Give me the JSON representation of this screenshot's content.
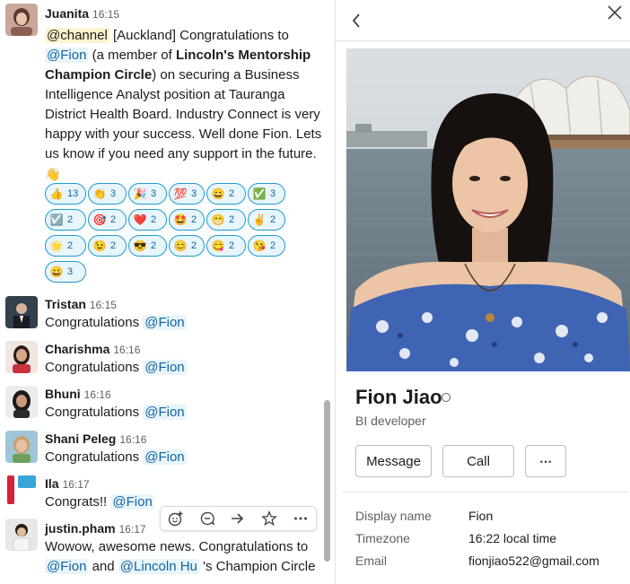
{
  "messages": [
    {
      "author": "Juanita",
      "time": "16:15",
      "parts": {
        "channel": "@channel",
        "p1": " [Auckland] Congratulations to ",
        "mention1": "@Fion",
        "p2": " (a member of ",
        "b1": "Lincoln's Mentorship Champion Circle",
        "p3": ") on securing a Business Intelligence Analyst position at Tauranga District Health Board. Industry Connect is very happy with your success. Well done Fion. Lets us know if you need any support in the future. ",
        "emoji": "👋"
      },
      "reactions": [
        {
          "emoji": "👍",
          "count": "13"
        },
        {
          "emoji": "👏",
          "count": "3"
        },
        {
          "emoji": "🎉",
          "count": "3"
        },
        {
          "emoji": "💯",
          "count": "3"
        },
        {
          "emoji": "😄",
          "count": "2"
        },
        {
          "emoji": "✅",
          "count": "3"
        },
        {
          "emoji": "☑️",
          "count": "2"
        },
        {
          "emoji": "🎯",
          "count": "2"
        },
        {
          "emoji": "❤️",
          "count": "2"
        },
        {
          "emoji": "🤩",
          "count": "2"
        },
        {
          "emoji": "😁",
          "count": "2"
        },
        {
          "emoji": "✌️",
          "count": "2"
        },
        {
          "emoji": "🌟",
          "count": "2"
        },
        {
          "emoji": "😉",
          "count": "2"
        },
        {
          "emoji": "😎",
          "count": "2"
        },
        {
          "emoji": "😊",
          "count": "2"
        },
        {
          "emoji": "😋",
          "count": "2"
        },
        {
          "emoji": "😘",
          "count": "2"
        },
        {
          "emoji": "😀",
          "count": "3"
        }
      ]
    },
    {
      "author": "Tristan",
      "time": "16:15",
      "text": "Congratulations ",
      "mention": "@Fion"
    },
    {
      "author": "Charishma",
      "time": "16:16",
      "text": "Congratulations ",
      "mention": "@Fion"
    },
    {
      "author": "Bhuni",
      "time": "16:16",
      "text": "Congratulations ",
      "mention": "@Fion"
    },
    {
      "author": "Shani Peleg",
      "time": "16:16",
      "text": "Congratulations ",
      "mention": "@Fion"
    },
    {
      "author": "Ila",
      "time": "16:17",
      "text": "Congrats!! ",
      "mention": "@Fion"
    },
    {
      "author": "justin.pham",
      "time": "16:17",
      "text": "Wowow, awesome news. Congratulations to ",
      "mention": "@Fion",
      "p2": " and ",
      "mention2": "@Lincoln Hu",
      "p3": " 's Champion Circle"
    }
  ],
  "hover_toolbar": [
    "add-reaction-icon",
    "reply-in-thread-icon",
    "share-message-icon",
    "save-star-icon",
    "more-actions-icon"
  ],
  "profile": {
    "name": "Fion Jiao",
    "title": "BI developer",
    "buttons": {
      "message": "Message",
      "call": "Call",
      "more": "⋯"
    },
    "fields": [
      {
        "label": "Display name",
        "value": "Fion"
      },
      {
        "label": "Timezone",
        "value": "16:22 local time"
      },
      {
        "label": "Email",
        "value": "fionjiao522@gmail.com"
      }
    ]
  },
  "colors": {
    "mention_text": "#1264a3",
    "mention_bg": "#e8f5fa",
    "reaction_border": "#1d9bd1",
    "muted_text": "#616061"
  }
}
